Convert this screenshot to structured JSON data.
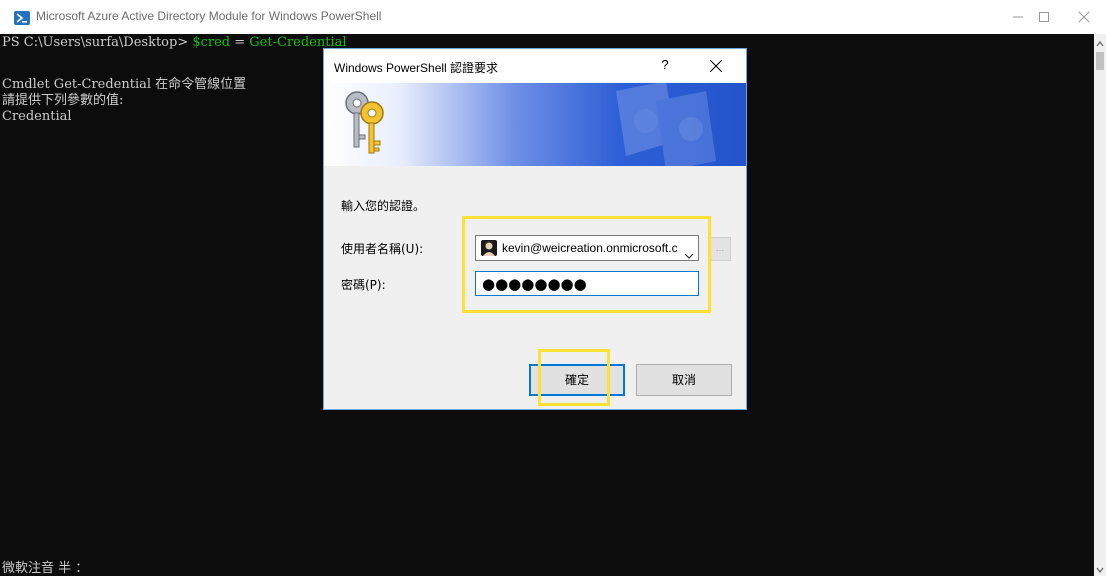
{
  "window": {
    "title": "Microsoft Azure Active Directory Module for Windows PowerShell",
    "icon": "powershell-icon",
    "controls": [
      "minimize-icon",
      "maximize-icon",
      "close-icon"
    ]
  },
  "console": {
    "prompt": "PS C:\\Users\\surfa\\Desktop> ",
    "command_var": "$cred",
    "command_eq": " = ",
    "command_cmdlet": "Get-Credential",
    "line2": "Cmdlet Get-Credential 在命令管線位置",
    "line3": "請提供下列參數的值:",
    "line4": "Credential",
    "ime_status": "微軟注音 半 ："
  },
  "dialog": {
    "title": "Windows PowerShell 認證要求",
    "help": "?",
    "prompt_text": "輸入您的認證。",
    "username_label": "使用者名稱(U):",
    "username_value": "kevin@weicreation.onmicrosoft.com",
    "password_label": "密碼(P):",
    "password_value": "●●●●●●●●",
    "browse_label": "...",
    "ok_label": "確定",
    "cancel_label": "取消"
  },
  "colors": {
    "console_bg": "#0c0c0c",
    "console_text": "#cccccc",
    "cmdlet_green": "#13c00d",
    "highlight_yellow": "#ffe135",
    "dialog_accent": "#0078d7"
  }
}
